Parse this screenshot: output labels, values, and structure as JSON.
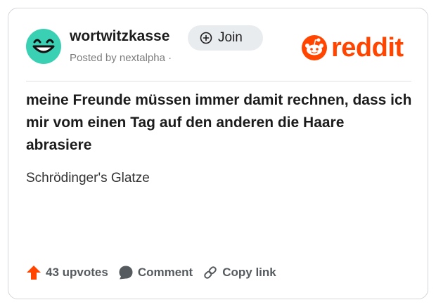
{
  "post": {
    "subreddit": "wortwitzkasse",
    "posted_by": "Posted by nextalpha ·",
    "join_label": "Join",
    "title": "meine Freunde müssen immer damit rechnen, dass ich mir vom einen Tag auf den anderen die Haare abrasiere",
    "body": "Schrödinger's Glatze"
  },
  "brand": {
    "wordmark": "reddit",
    "color": "#ff4500"
  },
  "actions": {
    "upvotes": "43 upvotes",
    "comment": "Comment",
    "copy_link": "Copy link"
  },
  "icons": {
    "avatar": "grinning-face-icon",
    "join": "plus-circle-icon",
    "brand": "reddit-snoo-icon",
    "upvote": "upvote-arrow-icon",
    "comment": "comment-bubble-icon",
    "link": "link-icon"
  },
  "colors": {
    "avatar_bg": "#3ad0b4",
    "upvote": "#ff4500",
    "text_muted": "#7c7c7c"
  }
}
